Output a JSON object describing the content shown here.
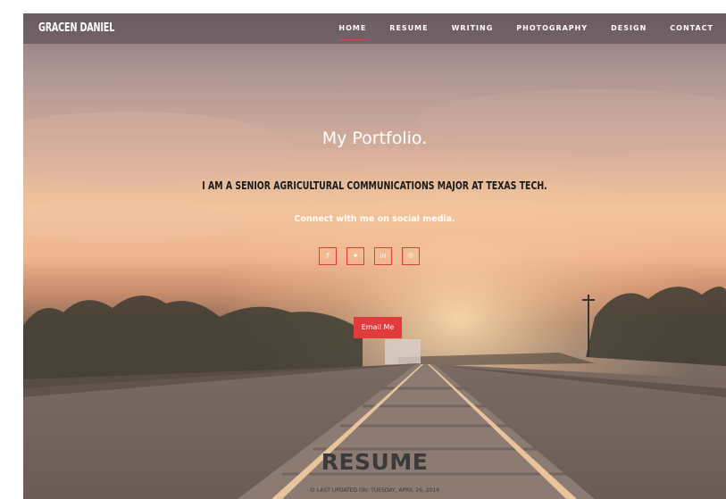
{
  "brand": "GRACEN DANIEL",
  "nav": {
    "items": [
      {
        "label": "HOME",
        "active": true
      },
      {
        "label": "RESUME",
        "active": false
      },
      {
        "label": "WRITING",
        "active": false
      },
      {
        "label": "PHOTOGRAPHY",
        "active": false
      },
      {
        "label": "DESIGN",
        "active": false
      },
      {
        "label": "CONTACT",
        "active": false
      }
    ]
  },
  "hero": {
    "title": "My Portfolio.",
    "subtitle": "I AM A SENIOR AGRICULTURAL COMMUNICATIONS MAJOR AT TEXAS TECH.",
    "connect": "Connect with me on social media.",
    "socials": [
      {
        "icon": "facebook-icon",
        "glyph": "f"
      },
      {
        "icon": "twitter-icon",
        "glyph": "✦"
      },
      {
        "icon": "linkedin-icon",
        "glyph": "in"
      },
      {
        "icon": "pinterest-icon",
        "glyph": "℗"
      }
    ],
    "email_button": "Email Me"
  },
  "resume": {
    "heading": "RESUME",
    "clock_icon": "clock-icon",
    "updated": "LAST UPDATED ON: TUESDAY, APRIL 26, 2016"
  },
  "colors": {
    "accent": "#e23b3b",
    "nav_bg": "rgba(80,70,75,0.55)"
  }
}
